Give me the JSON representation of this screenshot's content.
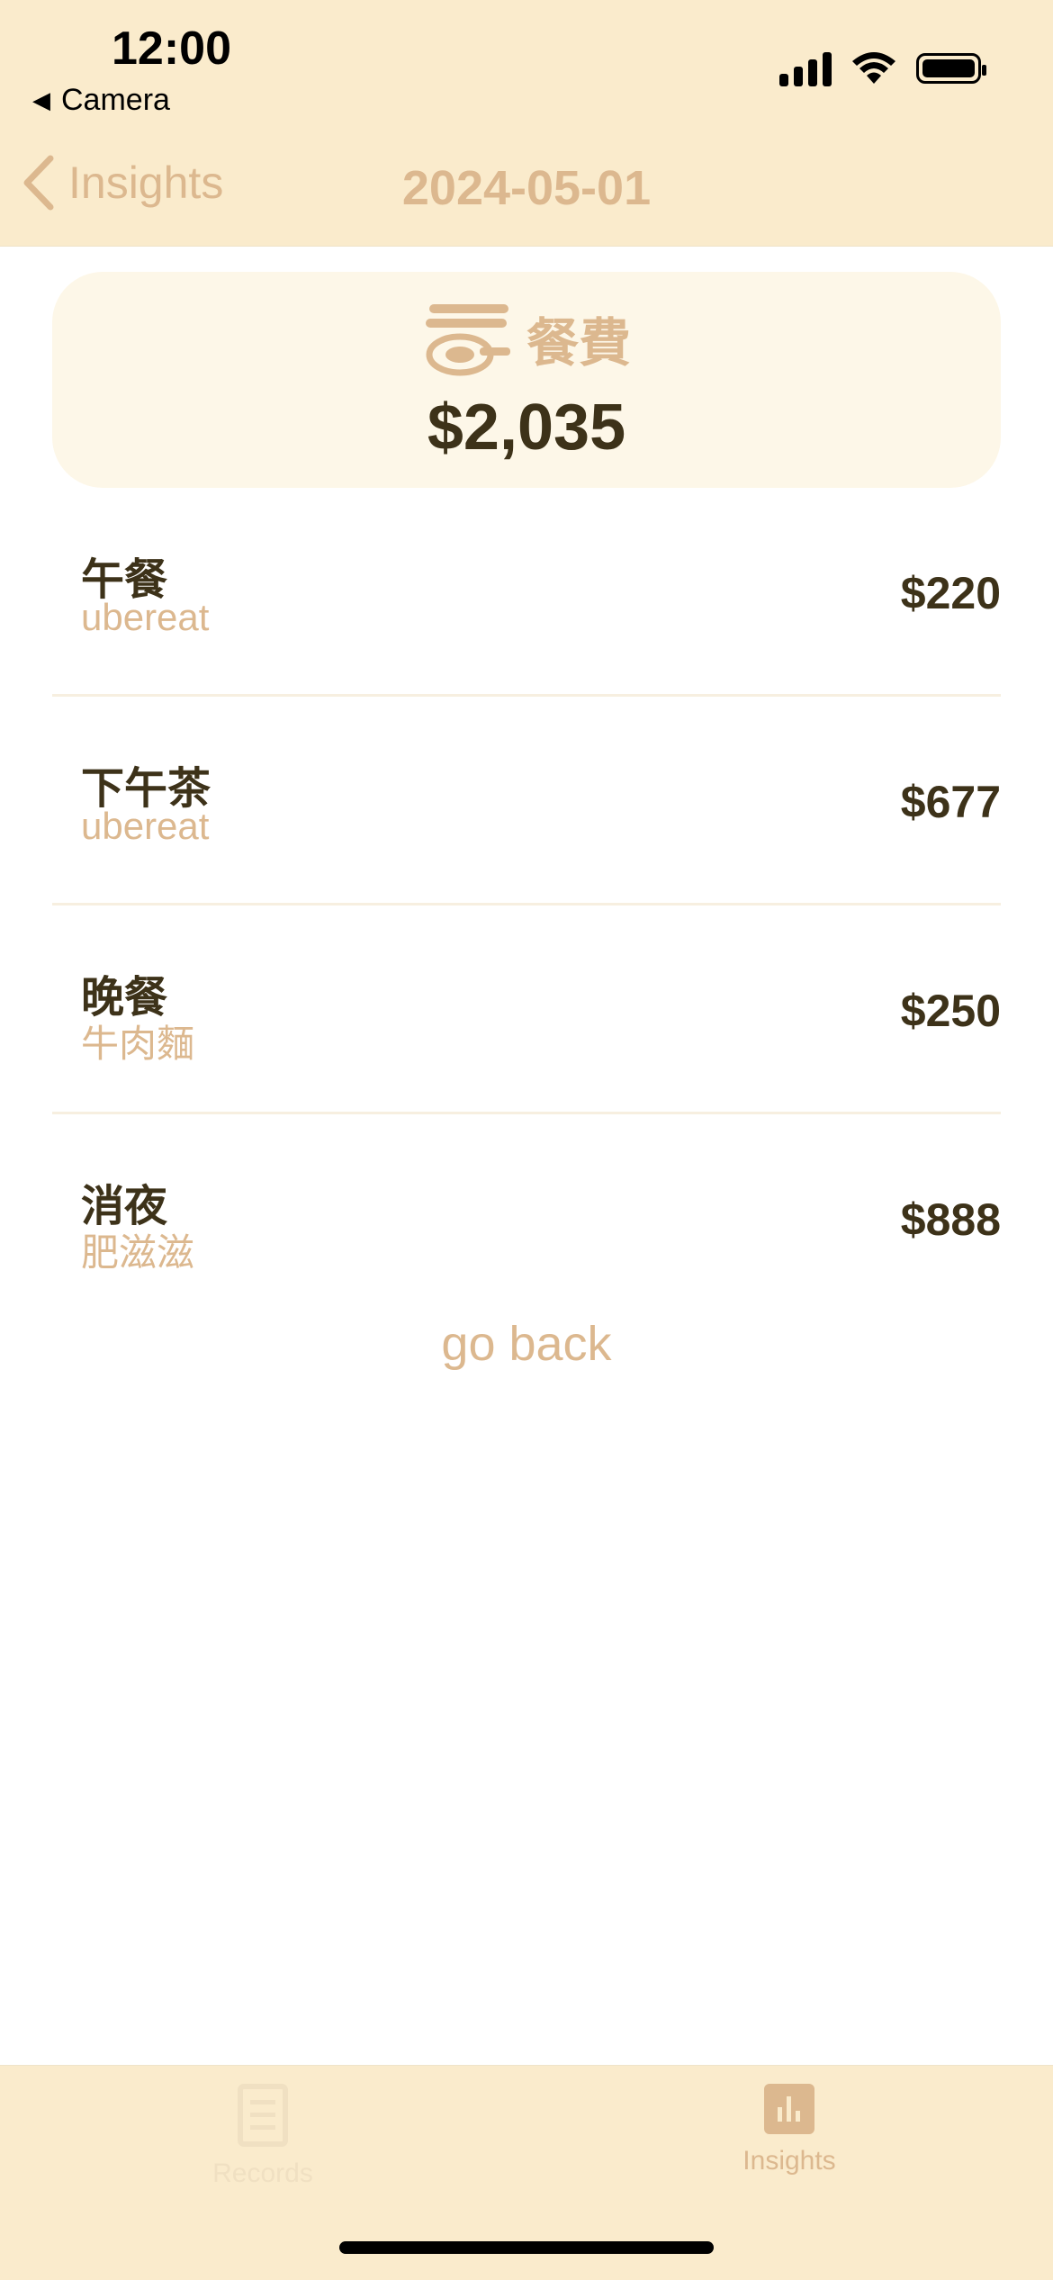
{
  "status": {
    "time": "12:00",
    "back_app": "Camera"
  },
  "nav": {
    "back_label": "Insights",
    "title": "2024-05-01"
  },
  "summary": {
    "category": "餐費",
    "total": "$2,035"
  },
  "items": [
    {
      "title": "午餐",
      "subtitle": "ubereat",
      "amount": "$220"
    },
    {
      "title": "下午茶",
      "subtitle": "ubereat",
      "amount": "$677"
    },
    {
      "title": "晚餐",
      "subtitle": "牛肉麵",
      "amount": "$250"
    },
    {
      "title": "消夜",
      "subtitle": "肥滋滋",
      "amount": "$888"
    }
  ],
  "go_back_label": "go back",
  "tabbar": {
    "records_label": "Records",
    "insights_label": "Insights"
  },
  "colors": {
    "header_bg": "#faebcc",
    "accent": "#dcb88f",
    "text": "#3d3219",
    "card_bg": "#fdf7e8"
  }
}
